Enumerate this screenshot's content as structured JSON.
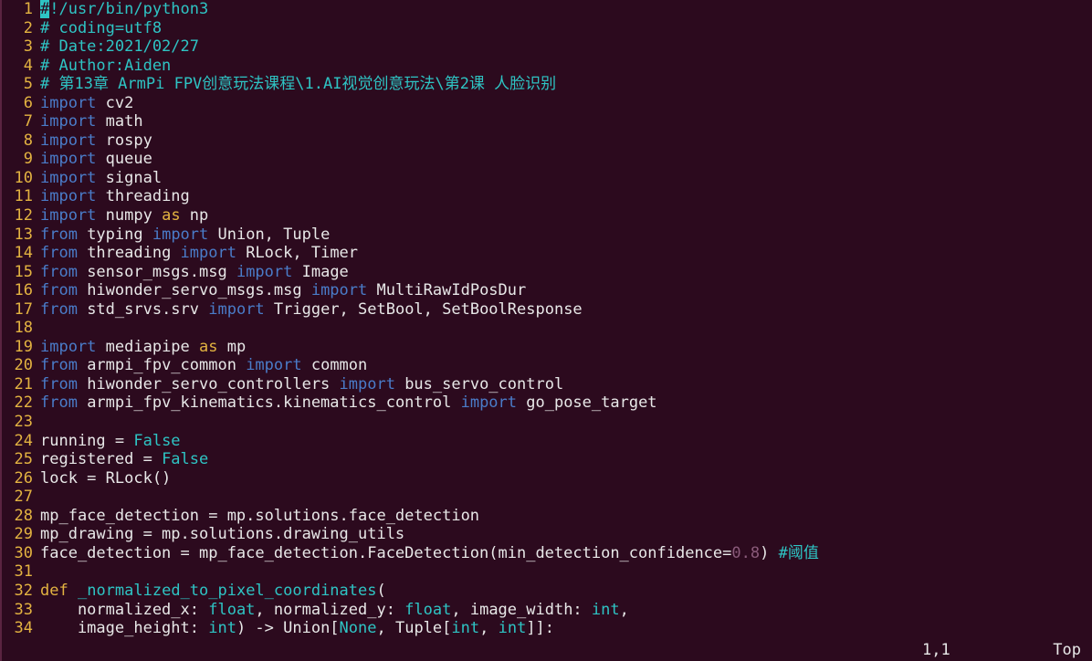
{
  "editor": {
    "lines": [
      {
        "n": "1",
        "t": [
          [
            "cursor",
            "#"
          ],
          [
            "cm",
            "!/usr/bin/python3"
          ]
        ]
      },
      {
        "n": "2",
        "t": [
          [
            "cm",
            "# coding=utf8"
          ]
        ]
      },
      {
        "n": "3",
        "t": [
          [
            "cm",
            "# Date:2021/02/27"
          ]
        ]
      },
      {
        "n": "4",
        "t": [
          [
            "cm",
            "# Author:Aiden"
          ]
        ]
      },
      {
        "n": "5",
        "t": [
          [
            "cm",
            "# 第13章 ArmPi FPV创意玩法课程\\1.AI视觉创意玩法\\第2课 人脸识别"
          ]
        ]
      },
      {
        "n": "6",
        "t": [
          [
            "kw",
            "import"
          ],
          [
            "p",
            " cv2"
          ]
        ]
      },
      {
        "n": "7",
        "t": [
          [
            "kw",
            "import"
          ],
          [
            "p",
            " math"
          ]
        ]
      },
      {
        "n": "8",
        "t": [
          [
            "kw",
            "import"
          ],
          [
            "p",
            " rospy"
          ]
        ]
      },
      {
        "n": "9",
        "t": [
          [
            "kw",
            "import"
          ],
          [
            "p",
            " queue"
          ]
        ]
      },
      {
        "n": "10",
        "t": [
          [
            "kw",
            "import"
          ],
          [
            "p",
            " signal"
          ]
        ]
      },
      {
        "n": "11",
        "t": [
          [
            "kw",
            "import"
          ],
          [
            "p",
            " threading"
          ]
        ]
      },
      {
        "n": "12",
        "t": [
          [
            "kw",
            "import"
          ],
          [
            "p",
            " numpy "
          ],
          [
            "kw2",
            "as"
          ],
          [
            "p",
            " np"
          ]
        ]
      },
      {
        "n": "13",
        "t": [
          [
            "kw",
            "from"
          ],
          [
            "p",
            " typing "
          ],
          [
            "kw",
            "import"
          ],
          [
            "p",
            " Union, Tuple"
          ]
        ]
      },
      {
        "n": "14",
        "t": [
          [
            "kw",
            "from"
          ],
          [
            "p",
            " threading "
          ],
          [
            "kw",
            "import"
          ],
          [
            "p",
            " RLock, Timer"
          ]
        ]
      },
      {
        "n": "15",
        "t": [
          [
            "kw",
            "from"
          ],
          [
            "p",
            " sensor_msgs.msg "
          ],
          [
            "kw",
            "import"
          ],
          [
            "p",
            " Image"
          ]
        ]
      },
      {
        "n": "16",
        "t": [
          [
            "kw",
            "from"
          ],
          [
            "p",
            " hiwonder_servo_msgs.msg "
          ],
          [
            "kw",
            "import"
          ],
          [
            "p",
            " MultiRawIdPosDur"
          ]
        ]
      },
      {
        "n": "17",
        "t": [
          [
            "kw",
            "from"
          ],
          [
            "p",
            " std_srvs.srv "
          ],
          [
            "kw",
            "import"
          ],
          [
            "p",
            " Trigger, SetBool, SetBoolResponse"
          ]
        ]
      },
      {
        "n": "18",
        "t": []
      },
      {
        "n": "19",
        "t": [
          [
            "kw",
            "import"
          ],
          [
            "p",
            " mediapipe "
          ],
          [
            "kw2",
            "as"
          ],
          [
            "p",
            " mp"
          ]
        ]
      },
      {
        "n": "20",
        "t": [
          [
            "kw",
            "from"
          ],
          [
            "p",
            " armpi_fpv_common "
          ],
          [
            "kw",
            "import"
          ],
          [
            "p",
            " common"
          ]
        ]
      },
      {
        "n": "21",
        "t": [
          [
            "kw",
            "from"
          ],
          [
            "p",
            " hiwonder_servo_controllers "
          ],
          [
            "kw",
            "import"
          ],
          [
            "p",
            " bus_servo_control"
          ]
        ]
      },
      {
        "n": "22",
        "t": [
          [
            "kw",
            "from"
          ],
          [
            "p",
            " armpi_fpv_kinematics.kinematics_control "
          ],
          [
            "kw",
            "import"
          ],
          [
            "p",
            " go_pose_target"
          ]
        ]
      },
      {
        "n": "23",
        "t": []
      },
      {
        "n": "24",
        "t": [
          [
            "p",
            "running = "
          ],
          [
            "bi",
            "False"
          ]
        ]
      },
      {
        "n": "25",
        "t": [
          [
            "p",
            "registered = "
          ],
          [
            "bi",
            "False"
          ]
        ]
      },
      {
        "n": "26",
        "t": [
          [
            "p",
            "lock = RLock()"
          ]
        ]
      },
      {
        "n": "27",
        "t": []
      },
      {
        "n": "28",
        "t": [
          [
            "p",
            "mp_face_detection = mp.solutions.face_detection"
          ]
        ]
      },
      {
        "n": "29",
        "t": [
          [
            "p",
            "mp_drawing = mp.solutions.drawing_utils"
          ]
        ]
      },
      {
        "n": "30",
        "t": [
          [
            "p",
            "face_detection = mp_face_detection.FaceDetection(min_detection_confidence="
          ],
          [
            "num",
            "0.8"
          ],
          [
            "p",
            ") "
          ],
          [
            "cm",
            "#阈值"
          ]
        ]
      },
      {
        "n": "31",
        "t": []
      },
      {
        "n": "32",
        "t": [
          [
            "kw2",
            "def"
          ],
          [
            "p",
            " "
          ],
          [
            "fn",
            "_normalized_to_pixel_coordinates"
          ],
          [
            "p",
            "("
          ]
        ]
      },
      {
        "n": "33",
        "t": [
          [
            "p",
            "    normalized_x: "
          ],
          [
            "bi",
            "float"
          ],
          [
            "p",
            ", normalized_y: "
          ],
          [
            "bi",
            "float"
          ],
          [
            "p",
            ", image_width: "
          ],
          [
            "bi",
            "int"
          ],
          [
            "p",
            ","
          ]
        ]
      },
      {
        "n": "34",
        "t": [
          [
            "p",
            "    image_height: "
          ],
          [
            "bi",
            "int"
          ],
          [
            "p",
            ") -> Union["
          ],
          [
            "bi",
            "None"
          ],
          [
            "p",
            ", Tuple["
          ],
          [
            "bi",
            "int"
          ],
          [
            "p",
            ", "
          ],
          [
            "bi",
            "int"
          ],
          [
            "p",
            "]]:"
          ]
        ]
      }
    ]
  },
  "status": {
    "position": "1,1",
    "scroll": "Top"
  },
  "colors": {
    "background": "#2c0a1e",
    "line_number": "#e3b341",
    "keyword": "#4a7cc9",
    "comment": "#2ec4c4",
    "text": "#e8e8e8"
  }
}
